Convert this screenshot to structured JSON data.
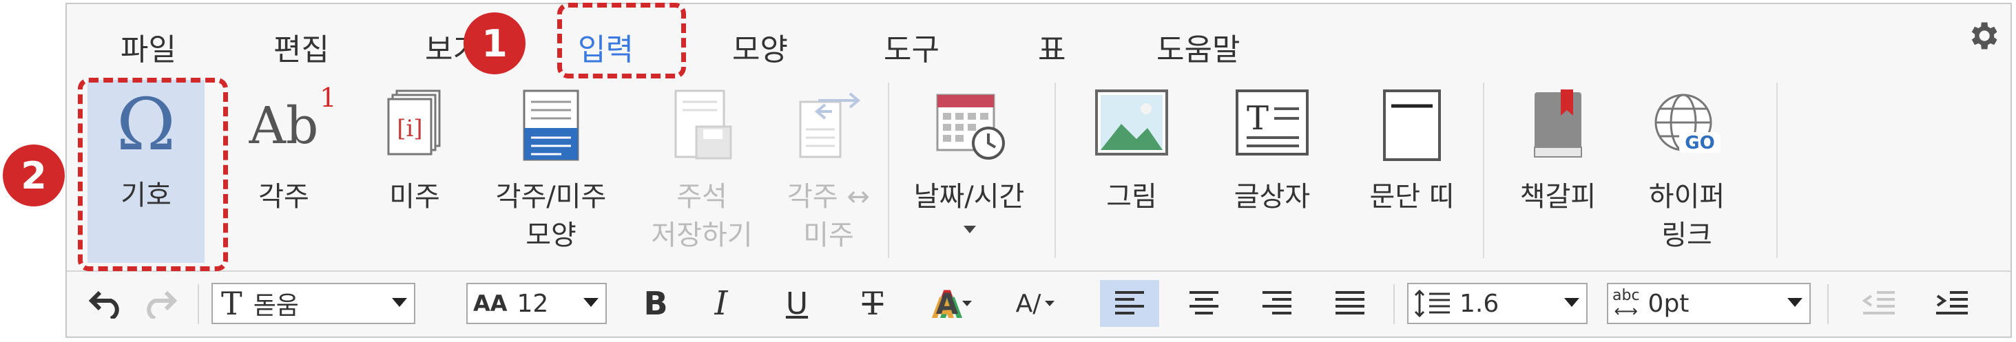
{
  "menu": {
    "tabs": [
      {
        "label": "파일"
      },
      {
        "label": "편집"
      },
      {
        "label": "보기"
      },
      {
        "label": "입력"
      },
      {
        "label": "모양"
      },
      {
        "label": "도구"
      },
      {
        "label": "표"
      },
      {
        "label": "도움말"
      }
    ],
    "active_tab": "입력",
    "settings_icon": "gear-icon"
  },
  "ribbon": {
    "symbol": {
      "label": "기호",
      "glyph": "Ω"
    },
    "footnote": {
      "label": "각주",
      "glyph": "Ab",
      "superscript": "1"
    },
    "endnote": {
      "label": "미주",
      "glyph": "[i]"
    },
    "note_shape": {
      "label_line1": "각주/미주",
      "label_line2": "모양"
    },
    "save_note": {
      "label_line1": "주석",
      "label_line2": "저장하기",
      "disabled": true
    },
    "convert_note": {
      "label_line1": "각주 ↔",
      "label_line2": "미주",
      "disabled": true
    },
    "date_time": {
      "label": "날짜/시간"
    },
    "picture": {
      "label": "그림"
    },
    "textbox": {
      "label": "글상자",
      "glyph": "T"
    },
    "paragraph_band": {
      "label": "문단 띠"
    },
    "bookmark": {
      "label": "책갈피"
    },
    "hyperlink": {
      "label_line1": "하이퍼",
      "label_line2": "링크",
      "glyph": "GO"
    }
  },
  "toolbar": {
    "font_name": "돋움",
    "font_size": "12",
    "font_size_glyph": "AA",
    "bold": "B",
    "italic": "I",
    "underline": "U",
    "strike": "T",
    "font_color_glyph": "A",
    "highlight_glyph": "A/",
    "line_spacing": "1.6",
    "paragraph_spacing_prefix": "abc",
    "paragraph_spacing": "0pt"
  },
  "callouts": [
    {
      "number": "1"
    },
    {
      "number": "2"
    }
  ],
  "colors": {
    "accent": "#3a7ae0",
    "callout": "#d2282a",
    "selected_bg": "#d3dff0"
  }
}
